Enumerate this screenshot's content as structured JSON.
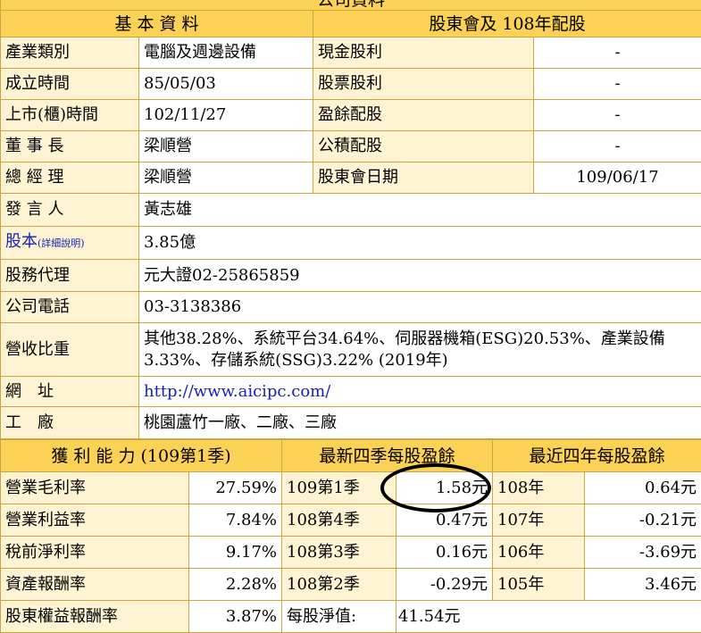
{
  "top_title": "公司資料",
  "basic": {
    "header": "基 本 資 料",
    "rows": [
      {
        "label": "產業類別",
        "value": "電腦及週邊設備"
      },
      {
        "label": "成立時間",
        "value": "85/05/03"
      },
      {
        "label": "上市(櫃)時間",
        "value": "102/11/27"
      },
      {
        "label": "董 事 長",
        "value": "梁順營"
      },
      {
        "label": "總 經 理",
        "value": "梁順營"
      }
    ],
    "spokesperson": {
      "label": "發 言 人",
      "value": "黃志雄"
    },
    "capital": {
      "label": "股本",
      "detail": "(詳細說明)",
      "value": "3.85億"
    },
    "agent": {
      "label": "股務代理",
      "value": "元大證02-25865859"
    },
    "phone": {
      "label": "公司電話",
      "value": "03-3138386"
    },
    "revenue": {
      "label": "營收比重",
      "value": "其他38.28%、系統平台34.64%、伺服器機箱(ESG)20.53%、產業設備3.33%、存儲系統(SSG)3.22% (2019年)"
    },
    "website": {
      "label": "網　址",
      "value": "http://www.aicipc.com/"
    },
    "factory": {
      "label": "工　廠",
      "value": "桃園蘆竹一廠、二廠、三廠"
    }
  },
  "dividend": {
    "header": "股東會及 108年配股",
    "rows": [
      {
        "label": "現金股利",
        "value": "-"
      },
      {
        "label": "股票股利",
        "value": "-"
      },
      {
        "label": "盈餘配股",
        "value": "-"
      },
      {
        "label": "公積配股",
        "value": "-"
      },
      {
        "label": "股東會日期",
        "value": "109/06/17"
      }
    ]
  },
  "profit": {
    "header": "獲 利 能 力 (109第1季)",
    "rows": [
      {
        "label": "營業毛利率",
        "value": "27.59%"
      },
      {
        "label": "營業利益率",
        "value": "7.84%"
      },
      {
        "label": "稅前淨利率",
        "value": "9.17%"
      },
      {
        "label": "資產報酬率",
        "value": "2.28%"
      },
      {
        "label": "股東權益報酬率",
        "value": "3.87%"
      }
    ]
  },
  "eps_quarter": {
    "header": "最新四季每股盈餘",
    "rows": [
      {
        "label": "109第1季",
        "value": "1.58元"
      },
      {
        "label": "108第4季",
        "value": "0.47元"
      },
      {
        "label": "108第3季",
        "value": "0.16元"
      },
      {
        "label": "108第2季",
        "value": "-0.29元"
      }
    ],
    "nav_label": "每股淨值:",
    "nav_value": "41.54元"
  },
  "eps_year": {
    "header": "最近四年每股盈餘",
    "rows": [
      {
        "label": "108年",
        "value": "0.64元"
      },
      {
        "label": "107年",
        "value": "-0.21元"
      },
      {
        "label": "106年",
        "value": "-3.69元"
      },
      {
        "label": "105年",
        "value": "3.46元"
      }
    ]
  }
}
